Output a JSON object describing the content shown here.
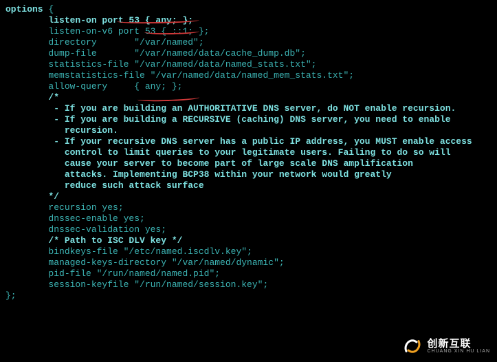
{
  "lines": {
    "l1a": "options",
    "l1b": " {",
    "l2a": "        listen-on port 53 { any; };",
    "l3": "        listen-on-v6 port 53 { ::1; };",
    "l4": "        directory       \"/var/named\";",
    "l5": "        dump-file       \"/var/named/data/cache_dump.db\";",
    "l6": "        statistics-file \"/var/named/data/named_stats.txt\";",
    "l7": "        memstatistics-file \"/var/named/data/named_mem_stats.txt\";",
    "l8": "        allow-query     { any; };",
    "l9": "",
    "l10": "        /*",
    "l11": "         - If you are building an AUTHORITATIVE DNS server, do NOT enable recursion.",
    "l12": "         - If you are building a RECURSIVE (caching) DNS server, you need to enable ",
    "l13": "           recursion. ",
    "l14": "         - If your recursive DNS server has a public IP address, you MUST enable access ",
    "l15": "           control to limit queries to your legitimate users. Failing to do so will",
    "l16": "           cause your server to become part of large scale DNS amplification ",
    "l17": "           attacks. Implementing BCP38 within your network would greatly",
    "l18": "           reduce such attack surface ",
    "l19": "        */",
    "l20": "        recursion yes;",
    "l21": "",
    "l22": "        dnssec-enable yes;",
    "l23": "        dnssec-validation yes;",
    "l24": "",
    "l25": "        /* Path to ISC DLV key */",
    "l26": "        bindkeys-file \"/etc/named.iscdlv.key\";",
    "l27": "",
    "l28": "        managed-keys-directory \"/var/named/dynamic\";",
    "l29": "",
    "l30": "        pid-file \"/run/named/named.pid\";",
    "l31": "        session-keyfile \"/run/named/session.key\";",
    "l32": "};"
  },
  "watermark": {
    "main": "创新互联",
    "sub": "CHUANG XIN HU LIAN"
  }
}
